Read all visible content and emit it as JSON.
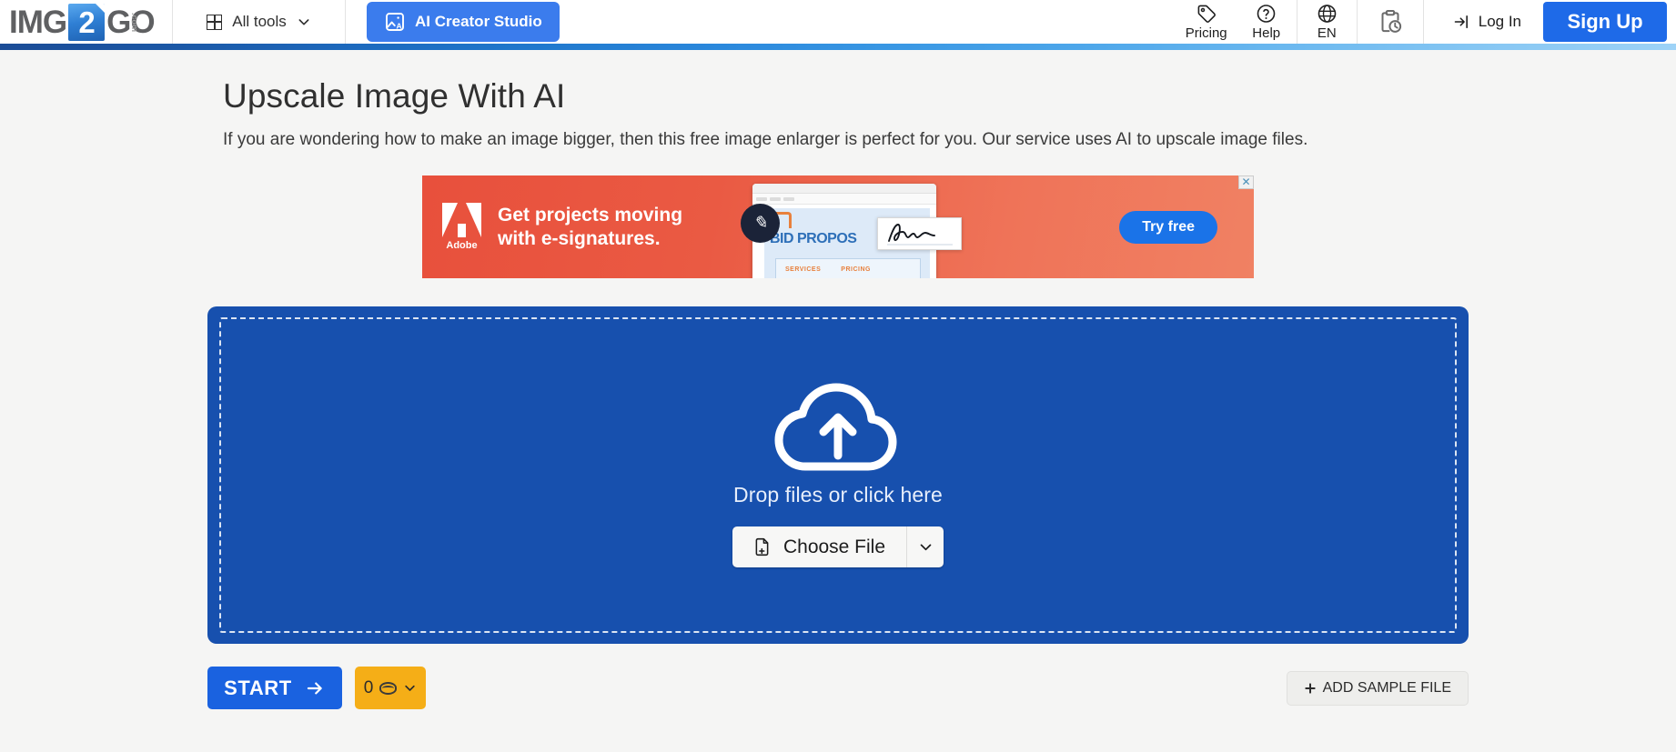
{
  "header": {
    "logo": {
      "part1": "IMG",
      "part2": "2",
      "part3": "GO",
      "domain_suffix": ".com"
    },
    "all_tools_label": "All tools",
    "ai_studio_label": "AI Creator Studio",
    "items": [
      {
        "label": "Pricing",
        "icon": "tag-icon"
      },
      {
        "label": "Help",
        "icon": "question-circle-icon"
      },
      {
        "label": "EN",
        "icon": "globe-icon"
      }
    ],
    "history_icon": "clipboard-clock-icon",
    "login_label": "Log In",
    "signup_label": "Sign Up"
  },
  "main": {
    "title": "Upscale Image With AI",
    "description": "If you are wondering how to make an image bigger, then this free image enlarger is perfect for you. Our service uses AI to upscale image files."
  },
  "ad": {
    "brand": "Adobe",
    "headline_line1": "Get projects moving",
    "headline_line2": "with e-signatures.",
    "cta_label": "Try free",
    "close_label": "✕",
    "mock": {
      "doc_title": "BID PROPOS",
      "nav_items": [
        "SERVICES",
        "PRICING"
      ]
    }
  },
  "dropzone": {
    "drop_text": "Drop files or click here",
    "choose_file_label": "Choose File",
    "cloud_icon": "cloud-upload-icon",
    "file_icon": "file-plus-icon",
    "caret_icon": "chevron-down-icon"
  },
  "actions": {
    "start_label": "START",
    "credits_value": "0",
    "credits_icon": "coin-icon",
    "add_sample_label": "ADD SAMPLE FILE"
  },
  "colors": {
    "brand_blue": "#1e6ae8",
    "dropzone_blue": "#1750ae",
    "credits_yellow": "#f5ae17",
    "ad_red": "#e8503c"
  }
}
